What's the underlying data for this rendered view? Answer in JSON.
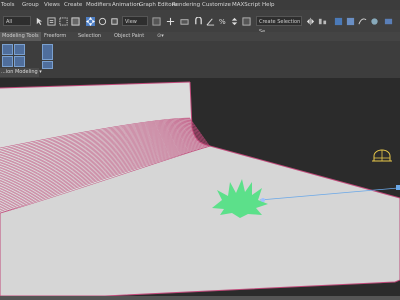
{
  "menu": {
    "items": [
      "Tools",
      "Group",
      "Views",
      "Create",
      "Modifiers",
      "Animation",
      "Graph Editors",
      "Rendering",
      "Customize",
      "MAXScript",
      "Help"
    ]
  },
  "toolbar": {
    "selection_filter": "All",
    "reference_coord": "View",
    "named_selection_placeholder": "Create Selection Se"
  },
  "ribbon": {
    "tabs": [
      "Modeling Tools",
      "Freeform",
      "Selection",
      "Object Paint"
    ],
    "active_tab": "Modeling Tools",
    "panel_label": "...ion Modeling"
  },
  "viewport": {
    "scene_objects": [
      "backdrop-plane",
      "grass-plant",
      "camera-target-line",
      "light-helper"
    ],
    "colors": {
      "background": "#2b2b2b",
      "floor": "#d6d6d6",
      "wall": "#dcdcdc",
      "wireframe": "#c04a7a",
      "plant": "#5ce08a",
      "target_line": "#6aa8e8",
      "helper": "#e8c84a"
    }
  }
}
